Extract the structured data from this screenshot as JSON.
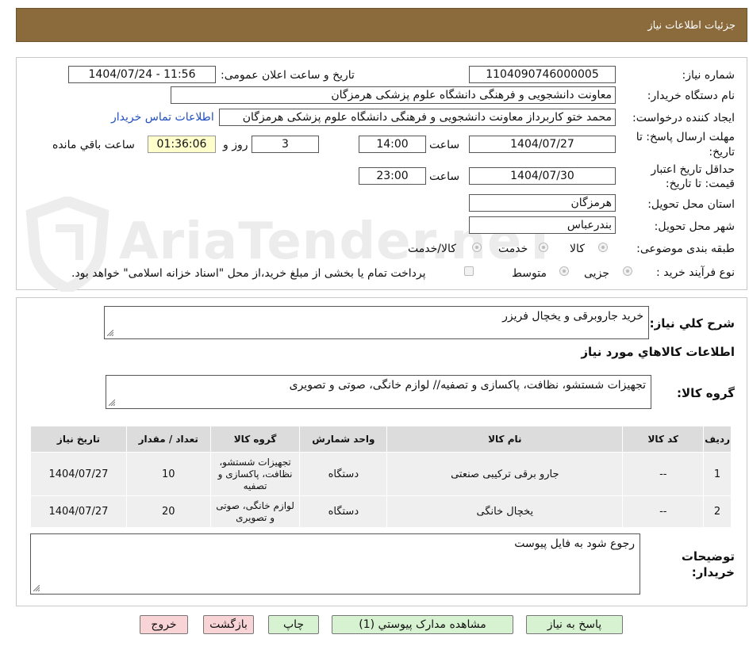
{
  "header": {
    "title": "جزئیات اطلاعات نیاز"
  },
  "watermark": {
    "text": "AriaTender.neT"
  },
  "form": {
    "need_number_label": "شماره نیاز:",
    "need_number": "1104090746000005",
    "announce_label": "تاریخ و ساعت اعلان عمومی:",
    "announce_value": "1404/07/24 - 11:56",
    "buyer_label": "نام دستگاه خریدار:",
    "buyer_value": "معاونت دانشجویی و فرهنگی دانشگاه علوم پزشکی هرمزگان",
    "creator_label": "ایجاد کننده درخواست:",
    "creator_value": "محمد ختو کاربرداز معاونت دانشجویی و فرهنگی دانشگاه علوم پزشکی هرمزگان",
    "contact_link": "اطلاعات تماس خریدار",
    "deadline_label_1": "مهلت ارسال پاسخ: تا",
    "deadline_label_2": "تاریخ:",
    "deadline_date": "1404/07/27",
    "time_label": "ساعت",
    "deadline_time": "14:00",
    "days_value": "3",
    "days_label": "روز و",
    "remaining_time": "01:36:06",
    "remaining_label": "ساعت باقي مانده",
    "validity_label_1": "حداقل تاریخ اعتبار",
    "validity_label_2": "قیمت: تا تاریخ:",
    "validity_date": "1404/07/30",
    "validity_time_label": "ساعت",
    "validity_time": "23:00",
    "province_label": "استان محل تحویل:",
    "province_value": "هرمزگان",
    "city_label": "شهر محل تحویل:",
    "city_value": "بندرعباس",
    "category_label": "طبقه بندی موضوعی:",
    "category_options": [
      "کالا",
      "خدمت",
      "کالا/خدمت"
    ],
    "process_label": "نوع فرآیند خرید :",
    "process_options": [
      "جزیی",
      "متوسط"
    ],
    "payment_note": "پرداخت تمام یا بخشی از مبلغ خرید،از محل \"اسناد خزانه اسلامی\" خواهد بود."
  },
  "details": {
    "summary_label": "شرح کلي نیاز:",
    "summary_value": "خرید جاروبرقی و یخچال فریزر",
    "goods_info_title": "اطلاعات کالاهاي مورد نیاز",
    "goods_group_label": "گروه کالا:",
    "goods_group_value": "تجهیزات شستشو، نظافت، پاکسازی و تصفیه// لوازم خانگی، صوتی و تصویری",
    "table": {
      "headers": [
        "ردیف",
        "کد کالا",
        "نام کالا",
        "واحد شمارش",
        "گروه کالا",
        "تعداد / مقدار",
        "تاریخ نیاز"
      ],
      "rows": [
        [
          "1",
          "--",
          "جارو برقی ترکیبی صنعتی",
          "دستگاه",
          "تجهیزات شستشو، نظافت، پاکسازی و تصفیه",
          "10",
          "1404/07/27"
        ],
        [
          "2",
          "--",
          "یخچال خانگی",
          "دستگاه",
          "لوازم خانگی، صوتی و تصویری",
          "20",
          "1404/07/27"
        ]
      ]
    },
    "notes_label_1": "توضیحات",
    "notes_label_2": "خریدار:",
    "notes_value": "رجوع شود به فایل پیوست"
  },
  "buttons": {
    "reply": "پاسخ به نیاز",
    "attachments": "مشاهده مدارک پیوستي (1)",
    "print": "چاپ",
    "back": "بازگشت",
    "exit": "خروج"
  },
  "colors": {
    "header_bg": "#8b6a3c",
    "remaining_bg": "#ffffcc",
    "button_green": "#d6f2d0",
    "button_pink": "#f8d4d6",
    "link": "#1f4fc1"
  }
}
